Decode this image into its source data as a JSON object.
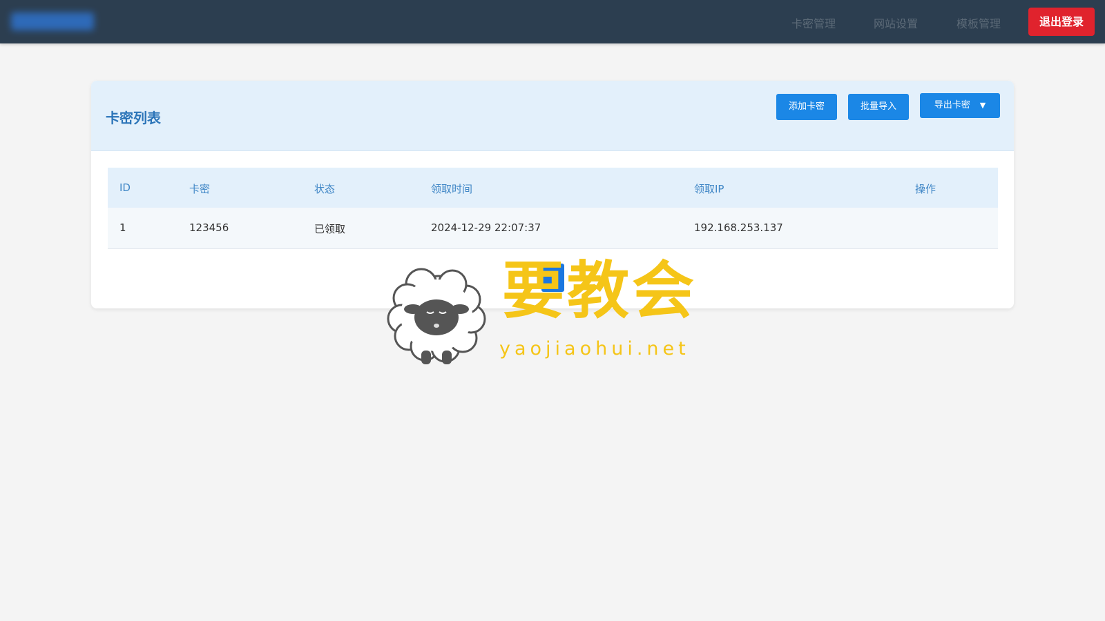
{
  "navbar": {
    "nav_items": [
      "卡密管理",
      "网站设置",
      "模板管理"
    ],
    "logout_label": "退出登录"
  },
  "card": {
    "title": "卡密列表",
    "buttons": {
      "add": "添加卡密",
      "import": "批量导入",
      "export": "导出卡密",
      "export_caret": "▼"
    }
  },
  "table": {
    "headers": [
      "ID",
      "卡密",
      "状态",
      "领取时间",
      "领取IP",
      "操作"
    ],
    "rows": [
      [
        "1",
        "123456",
        "已领取",
        "2024-12-29 22:07:37",
        "192.168.253.137",
        ""
      ]
    ]
  },
  "watermark": {
    "text": "要教会",
    "url": "yaojiaohui.net"
  },
  "colors": {
    "navbar": "#2c3e50",
    "accent": "#1b87e6",
    "danger": "#e0232d",
    "watermark": "#f5c518"
  }
}
